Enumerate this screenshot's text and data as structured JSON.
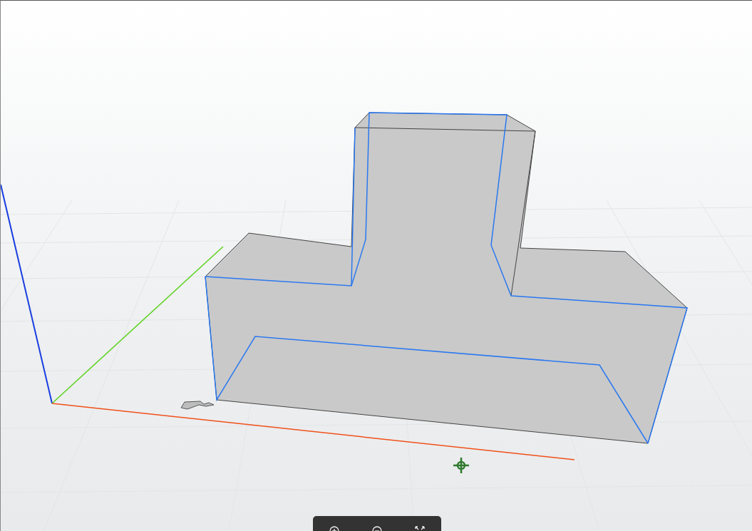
{
  "viewport": {
    "toolbar": {
      "buttons": [
        {
          "kind": "zoom-in"
        },
        {
          "kind": "zoom-out"
        },
        {
          "kind": "fullscreen"
        }
      ]
    }
  }
}
